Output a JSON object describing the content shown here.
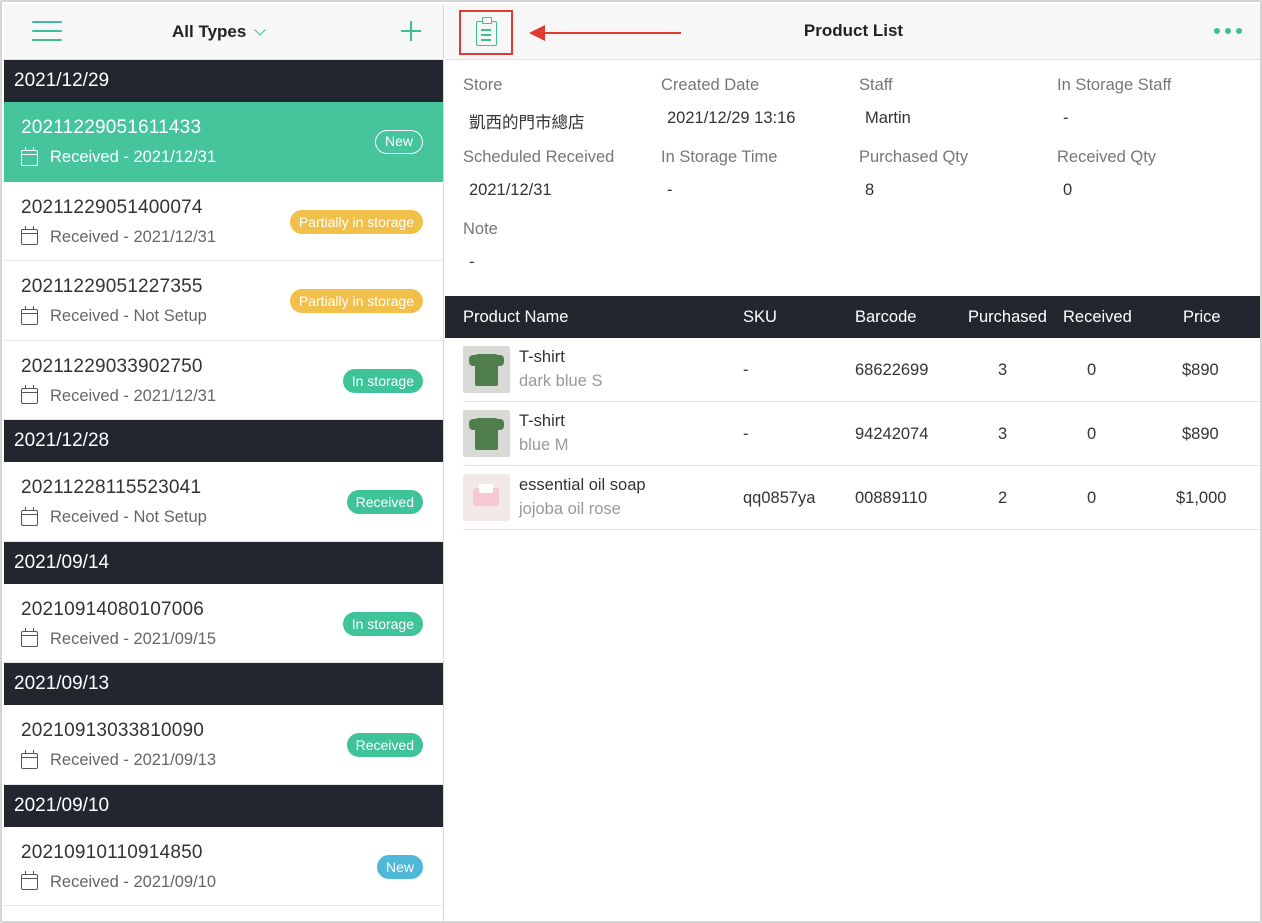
{
  "left": {
    "filter_label": "All Types",
    "groups": [
      {
        "date": "2021/12/29",
        "orders": [
          {
            "id": "20211229051611433",
            "sub": "Received - 2021/12/31",
            "status": "New"
          },
          {
            "id": "20211229051400074",
            "sub": "Received - 2021/12/31",
            "status": "Partially in storage"
          },
          {
            "id": "20211229051227355",
            "sub": "Received - Not Setup",
            "status": "Partially in storage"
          },
          {
            "id": "20211229033902750",
            "sub": "Received - 2021/12/31",
            "status": "In storage"
          }
        ]
      },
      {
        "date": "2021/12/28",
        "orders": [
          {
            "id": "20211228115523041",
            "sub": "Received - Not Setup",
            "status": "Received"
          }
        ]
      },
      {
        "date": "2021/09/14",
        "orders": [
          {
            "id": "20210914080107006",
            "sub": "Received - 2021/09/15",
            "status": "In storage"
          }
        ]
      },
      {
        "date": "2021/09/13",
        "orders": [
          {
            "id": "20210913033810090",
            "sub": "Received - 2021/09/13",
            "status": "Received"
          }
        ]
      },
      {
        "date": "2021/09/10",
        "orders": [
          {
            "id": "20210910110914850",
            "sub": "Received - 2021/09/10",
            "status": "New"
          }
        ]
      }
    ]
  },
  "right": {
    "title": "Product List",
    "fields": {
      "store": {
        "label": "Store",
        "value": "凱西的門市總店"
      },
      "created_date": {
        "label": "Created Date",
        "value": "2021/12/29 13:16"
      },
      "staff": {
        "label": "Staff",
        "value": "Martin"
      },
      "in_storage_staff": {
        "label": "In Storage Staff",
        "value": "-"
      },
      "scheduled_received": {
        "label": "Scheduled Received",
        "value": "2021/12/31"
      },
      "in_storage_time": {
        "label": "In Storage Time",
        "value": "-"
      },
      "purchased_qty": {
        "label": "Purchased Qty",
        "value": "8"
      },
      "received_qty": {
        "label": "Received Qty",
        "value": "0"
      },
      "note": {
        "label": "Note",
        "value": "-"
      }
    },
    "table": {
      "headers": {
        "name": "Product Name",
        "sku": "SKU",
        "barcode": "Barcode",
        "purchased": "Purchased",
        "received": "Received",
        "price": "Price"
      },
      "rows": [
        {
          "name": "T-shirt",
          "variant": "dark blue S",
          "sku": "-",
          "barcode": "68622699",
          "purchased": "3",
          "received": "0",
          "price": "$890"
        },
        {
          "name": "T-shirt",
          "variant": "blue M",
          "sku": "-",
          "barcode": "94242074",
          "purchased": "3",
          "received": "0",
          "price": "$890"
        },
        {
          "name": "essential oil soap",
          "variant": "jojoba oil rose",
          "sku": "qq0857ya",
          "barcode": "00889110",
          "purchased": "2",
          "received": "0",
          "price": "$1,000"
        }
      ]
    }
  },
  "colors": {
    "accent": "#3cbf97",
    "header_dark": "#23262f",
    "highlight_red": "#e13b2f",
    "badge_new": "#4fb8d8",
    "badge_partial": "#f0c04a"
  }
}
